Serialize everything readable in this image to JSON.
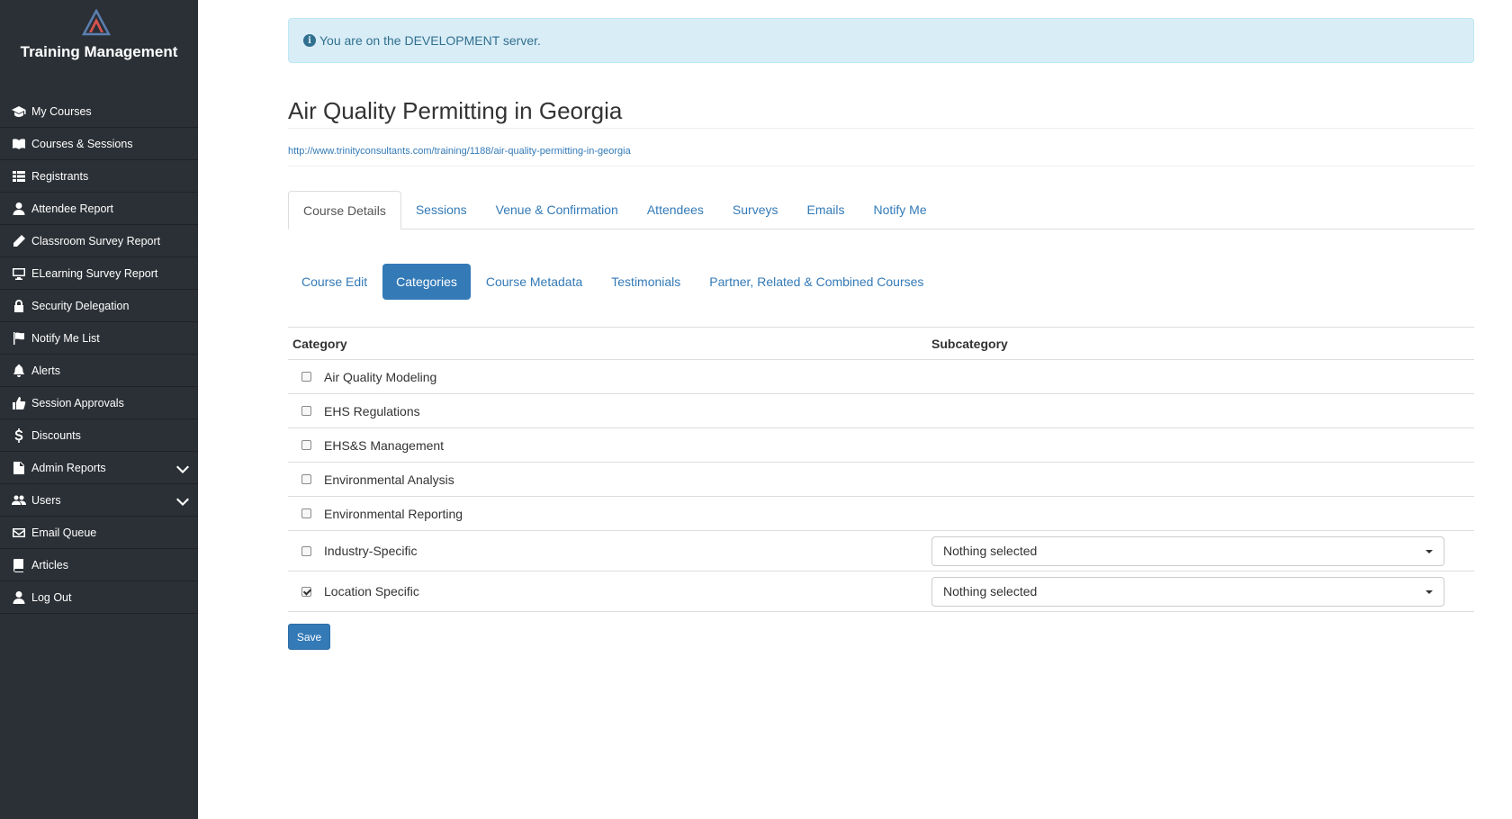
{
  "app": {
    "title": "Training Management"
  },
  "sidebar": {
    "items": [
      {
        "label": "My Courses",
        "icon": "graduation-cap-icon"
      },
      {
        "label": "Courses & Sessions",
        "icon": "open-book-icon"
      },
      {
        "label": "Registrants",
        "icon": "list-table-icon"
      },
      {
        "label": "Attendee Report",
        "icon": "user-icon"
      },
      {
        "label": "Classroom Survey Report",
        "icon": "pencil-icon"
      },
      {
        "label": "ELearning Survey Report",
        "icon": "monitor-icon"
      },
      {
        "label": "Security Delegation",
        "icon": "lock-icon"
      },
      {
        "label": "Notify Me List",
        "icon": "flag-icon"
      },
      {
        "label": "Alerts",
        "icon": "bell-icon"
      },
      {
        "label": "Session Approvals",
        "icon": "thumbs-up-icon"
      },
      {
        "label": "Discounts",
        "icon": "dollar-icon"
      },
      {
        "label": "Admin Reports",
        "icon": "file-icon",
        "expandable": true
      },
      {
        "label": "Users",
        "icon": "users-icon",
        "expandable": true
      },
      {
        "label": "Email Queue",
        "icon": "envelope-icon"
      },
      {
        "label": "Articles",
        "icon": "book-icon"
      },
      {
        "label": "Log Out",
        "icon": "user-icon"
      }
    ]
  },
  "alert": {
    "text": "You are on the DEVELOPMENT server.",
    "icon": "info-circle-icon"
  },
  "page": {
    "title": "Air Quality Permitting in Georgia",
    "link": "http://www.trinityconsultants.com/training/1188/air-quality-permitting-in-georgia"
  },
  "tabs": [
    "Course Details",
    "Sessions",
    "Venue & Confirmation",
    "Attendees",
    "Surveys",
    "Emails",
    "Notify Me"
  ],
  "active_tab": "Course Details",
  "subtabs": [
    "Course Edit",
    "Categories",
    "Course Metadata",
    "Testimonials",
    "Partner, Related & Combined Courses"
  ],
  "active_subtab": "Categories",
  "table": {
    "headers": {
      "category": "Category",
      "subcategory": "Subcategory"
    },
    "rows": [
      {
        "category": "Air Quality Modeling",
        "checked": false,
        "subcategory": null
      },
      {
        "category": "EHS Regulations",
        "checked": false,
        "subcategory": null
      },
      {
        "category": "EHS&S Management",
        "checked": false,
        "subcategory": null
      },
      {
        "category": "Environmental Analysis",
        "checked": false,
        "subcategory": null
      },
      {
        "category": "Environmental Reporting",
        "checked": false,
        "subcategory": null
      },
      {
        "category": "Industry-Specific",
        "checked": false,
        "subcategory": "Nothing selected"
      },
      {
        "category": "Location Specific",
        "checked": true,
        "subcategory": "Nothing selected"
      }
    ]
  },
  "save_label": "Save",
  "colors": {
    "sidebar_bg": "#2b3036",
    "primary": "#337ab7",
    "alert_bg": "#d9edf7",
    "alert_text": "#31708f"
  }
}
